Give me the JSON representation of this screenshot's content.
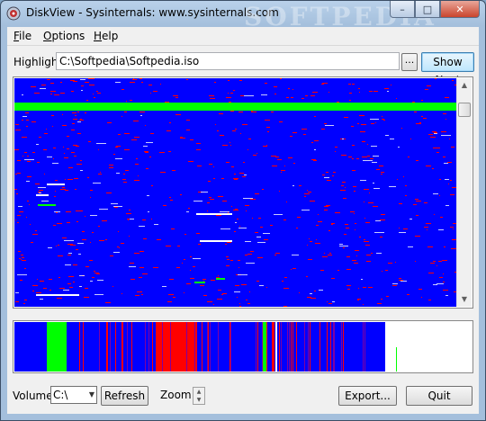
{
  "window": {
    "title": "DiskView - Sysinternals: www.sysinternals.com",
    "minimize_glyph": "–",
    "maximize_glyph": "□",
    "close_glyph": "✕"
  },
  "menu": {
    "items": [
      {
        "accel": "F",
        "rest": "ile"
      },
      {
        "accel": "O",
        "rest": "ptions"
      },
      {
        "accel": "H",
        "rest": "elp"
      }
    ]
  },
  "highlight": {
    "label": "Highlight:",
    "value": "C:\\Softpedia\\Softpedia.iso",
    "browse_label": "...",
    "show_next_label": "Show Next"
  },
  "controls": {
    "volume_label": "Volume:",
    "volume_value": "C:\\",
    "refresh_label": "Refresh",
    "zoom_label": "Zoom:",
    "export_label": "Export...",
    "quit_label": "Quit"
  },
  "colors": {
    "used": "#0000ff",
    "highlight": "#00ff00",
    "system": "#ff0000",
    "free": "#ffffff"
  },
  "watermark": "SOFTPEDIA"
}
